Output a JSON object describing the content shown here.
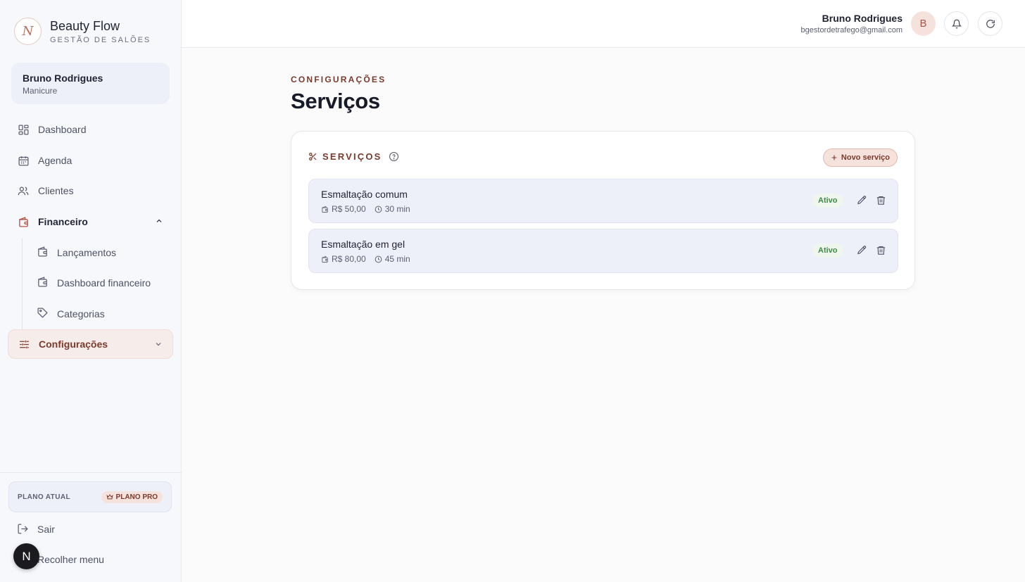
{
  "brand": {
    "logo_letter": "N",
    "name": "Beauty Flow",
    "subtitle": "GESTÃO DE SALÕES"
  },
  "user_card": {
    "name": "Bruno Rodrigues",
    "role": "Manicure"
  },
  "nav": {
    "dashboard": "Dashboard",
    "agenda": "Agenda",
    "clientes": "Clientes",
    "financeiro": "Financeiro",
    "financeiro_sub": [
      "Lançamentos",
      "Dashboard financeiro",
      "Categorias"
    ],
    "configuracoes": "Configurações"
  },
  "plan": {
    "label": "PLANO ATUAL",
    "badge": "PLANO PRO"
  },
  "footer": {
    "logout": "Sair",
    "collapse": "Recolher menu",
    "fab_letter": "N"
  },
  "topbar": {
    "user_name": "Bruno Rodrigues",
    "user_email": "bgestordetrafego@gmail.com",
    "avatar_letter": "B"
  },
  "page": {
    "eyebrow": "CONFIGURAÇÕES",
    "title": "Serviços"
  },
  "services_card": {
    "title": "SERVIÇOS",
    "new_button": "Novo serviço",
    "items": [
      {
        "name": "Esmaltação comum",
        "price": "R$ 50,00",
        "duration": "30 min",
        "status": "Ativo"
      },
      {
        "name": "Esmaltação em gel",
        "price": "R$ 80,00",
        "duration": "45 min",
        "status": "Ativo"
      }
    ]
  },
  "colors": {
    "accent": "#7a3a2c",
    "accent_bg": "#f6e2dc",
    "active_status": "#3e8a48",
    "row_bg": "#edf0f8"
  }
}
